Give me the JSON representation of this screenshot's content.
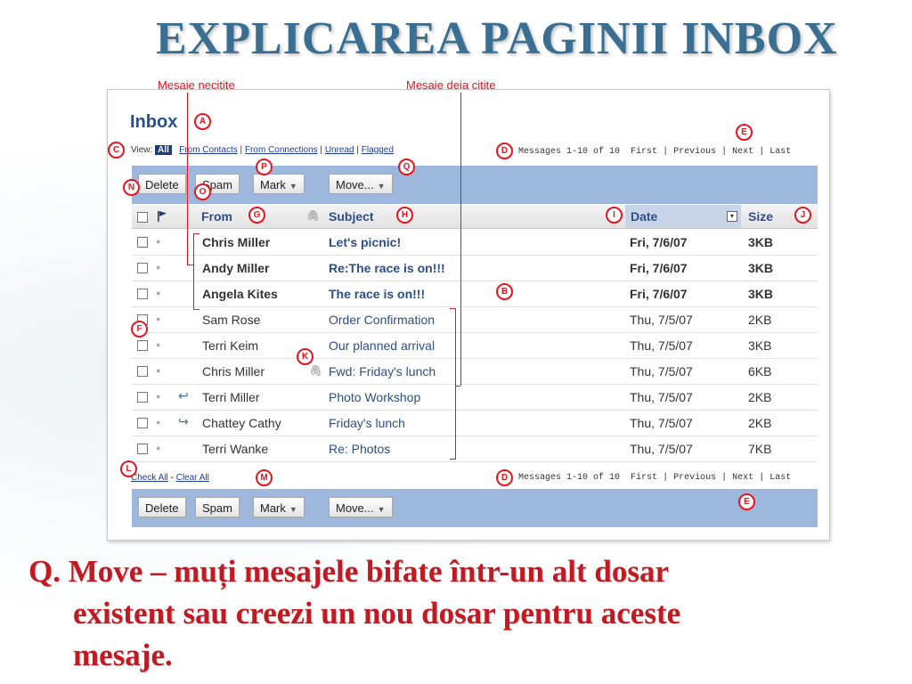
{
  "slide": {
    "title": "EXPLICAREA PAGINII INBOX",
    "caption_line1": "Q. Move – muți mesajele bifate într-un alt dosar",
    "caption_line2": "existent sau creezi un nou dosar pentru aceste",
    "caption_line3": "mesaje."
  },
  "annotations": {
    "unread_label": "Mesaje necitite",
    "read_label": "Mesaje deja citite",
    "markers": {
      "A": "A",
      "B": "B",
      "C": "C",
      "D": "D",
      "E": "E",
      "F": "F",
      "G": "G",
      "H": "H",
      "I": "I",
      "J": "J",
      "K": "K",
      "L": "L",
      "M": "M",
      "N": "N",
      "O": "O",
      "P": "P",
      "Q": "Q"
    }
  },
  "inbox": {
    "title": "Inbox",
    "view": {
      "label": "View:",
      "all": "All",
      "from_contacts": "From Contacts",
      "from_connections": "From Connections",
      "unread": "Unread",
      "flagged": "Flagged",
      "sep": "|"
    },
    "pager": {
      "messages": "Messages 1-10 of 10",
      "first": "First",
      "previous": "Previous",
      "next": "Next",
      "last": "Last",
      "sep": "|"
    },
    "toolbar": {
      "delete": "Delete",
      "spam": "Spam",
      "mark": "Mark",
      "move": "Move...",
      "caret": "▼"
    },
    "columns": {
      "from": "From",
      "subject": "Subject",
      "date": "Date",
      "size": "Size"
    },
    "messages": [
      {
        "from": "Chris Miller",
        "subject": "Let's picnic!",
        "date": "Fri, 7/6/07",
        "size": "3KB",
        "unread": true,
        "icon": ""
      },
      {
        "from": "Andy Miller",
        "subject": "Re:The race is on!!!",
        "date": "Fri, 7/6/07",
        "size": "3KB",
        "unread": true,
        "icon": ""
      },
      {
        "from": "Angela Kites",
        "subject": "The race is on!!!",
        "date": "Fri, 7/6/07",
        "size": "3KB",
        "unread": true,
        "icon": ""
      },
      {
        "from": "Sam Rose",
        "subject": "Order Confirmation",
        "date": "Thu, 7/5/07",
        "size": "2KB",
        "unread": false,
        "icon": ""
      },
      {
        "from": "Terri Keim",
        "subject": "Our planned arrival",
        "date": "Thu, 7/5/07",
        "size": "3KB",
        "unread": false,
        "icon": ""
      },
      {
        "from": "Chris Miller",
        "subject": "Fwd: Friday's lunch",
        "date": "Thu, 7/5/07",
        "size": "6KB",
        "unread": false,
        "icon": "attachment-icon"
      },
      {
        "from": "Terri Miller",
        "subject": "Photo Workshop",
        "date": "Thu, 7/5/07",
        "size": "2KB",
        "unread": false,
        "icon": "replied-icon"
      },
      {
        "from": "Chattey Cathy",
        "subject": "Friday's lunch",
        "date": "Thu, 7/5/07",
        "size": "2KB",
        "unread": false,
        "icon": "forwarded-icon"
      },
      {
        "from": "Terri Wanke",
        "subject": "Re: Photos",
        "date": "Thu, 7/5/07",
        "size": "7KB",
        "unread": false,
        "icon": ""
      }
    ],
    "footer": {
      "check_all": "Check All",
      "dash": "-",
      "clear_all": "Clear All"
    }
  },
  "colors": {
    "title": "#3a6f92",
    "annotation": "#e8141f",
    "toolbar": "#9db7dd",
    "link": "#2b4f8a",
    "caption": "#c21a22"
  }
}
